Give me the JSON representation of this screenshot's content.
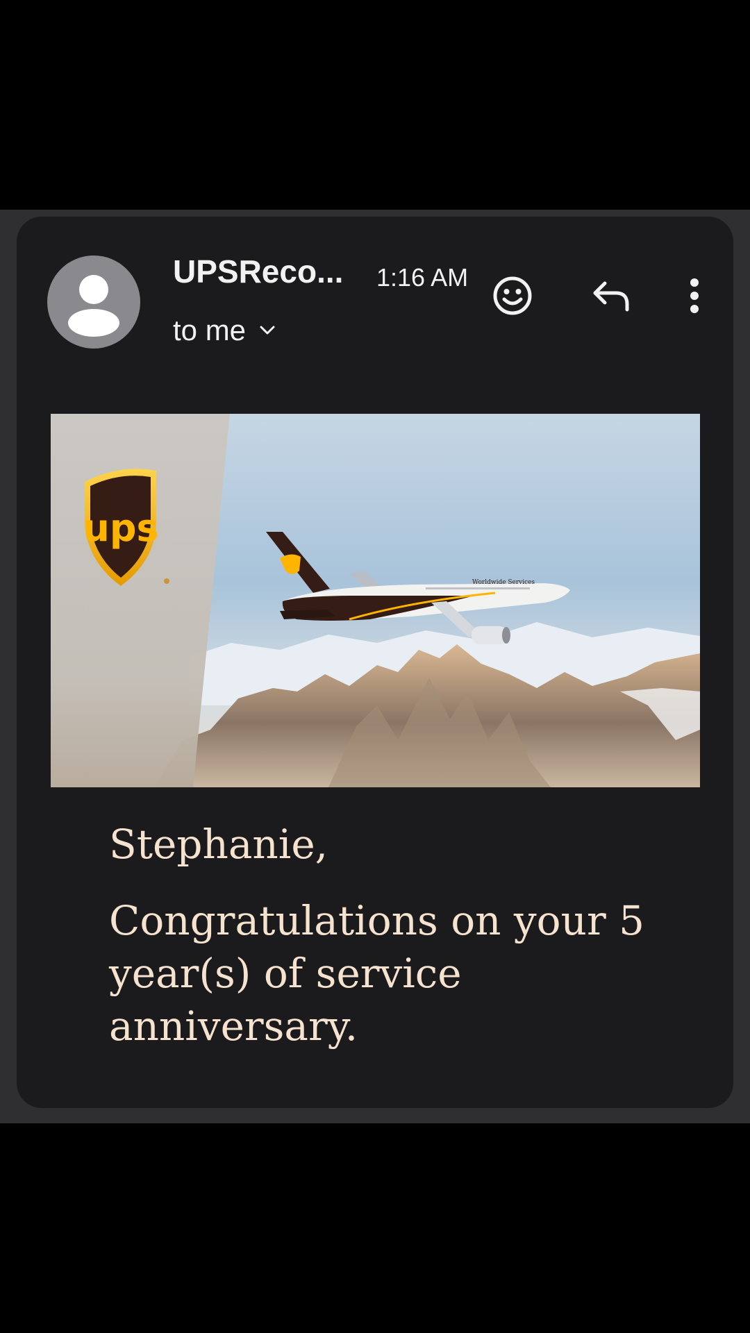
{
  "email": {
    "sender": "UPSReco...",
    "time": "1:16 AM",
    "recipient_label": "to me",
    "icons": {
      "avatar": "person-icon",
      "recipient_toggle": "chevron-down-icon",
      "emoji": "smiley-icon",
      "reply": "reply-icon",
      "more": "more-vert-icon"
    }
  },
  "banner": {
    "logo_text": "ups",
    "plane_livery_text": "Worldwide Services"
  },
  "body": {
    "greeting": "Stephanie,",
    "message": "Congratulations on your 5 year(s) of service anniversary."
  },
  "colors": {
    "card_background": "#1b1a1c",
    "body_text": "#f6e3cf",
    "ups_brown": "#351c15",
    "ups_gold": "#ffb500"
  }
}
